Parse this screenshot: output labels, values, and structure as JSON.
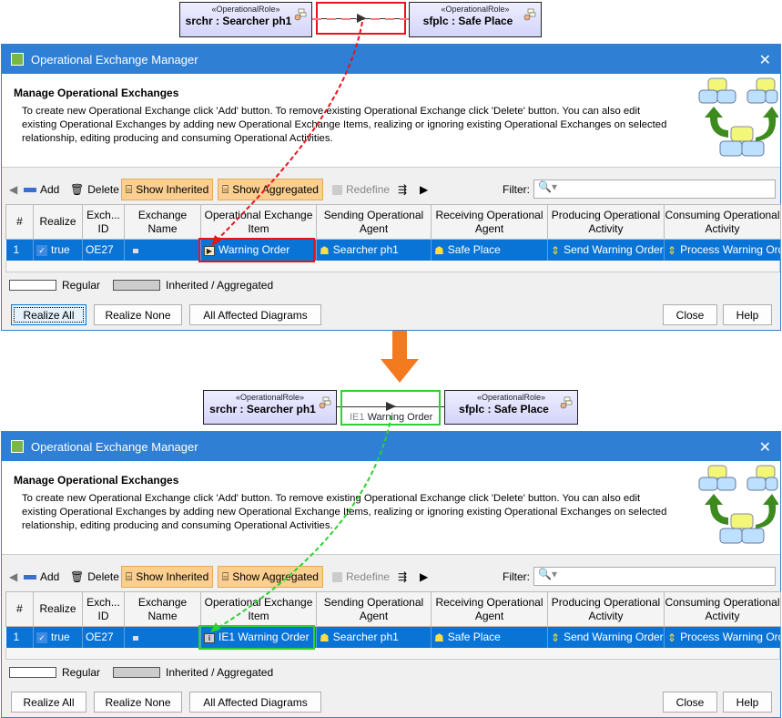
{
  "diagrams": [
    {
      "left": {
        "stereotype": "«OperationalRole»",
        "name": "srchr : Searcher ph1"
      },
      "right": {
        "stereotype": "«OperationalRole»",
        "name": "sfplc : Safe Place"
      },
      "connector_label": "",
      "highlight_color": "#e8141c"
    },
    {
      "left": {
        "stereotype": "«OperationalRole»",
        "name": "srchr : Searcher ph1"
      },
      "right": {
        "stereotype": "«OperationalRole»",
        "name": "sfplc : Safe Place"
      },
      "connector_label_prefix": "IE1",
      "connector_label": "Warning Order",
      "highlight_color": "#2fd12f"
    }
  ],
  "transition_arrow_color": "#f47a20",
  "dialogs": [
    {
      "title": "Operational Exchange Manager",
      "heading": "Manage Operational Exchanges",
      "description": "To create new Operational Exchange click 'Add' button. To remove existing Operational Exchange click 'Delete' button. You can also edit existing Operational Exchanges by adding new Operational Exchange Items, realizing or ignoring existing Operational Exchanges on selected relationship, editing producing and consuming Operational Activities.",
      "toolbar": {
        "add": "Add",
        "delete": "Delete",
        "show_inherited": "Show Inherited",
        "show_aggregated": "Show Aggregated",
        "redefine": "Redefine",
        "filter_label": "Filter:",
        "filter_value": ""
      },
      "columns": [
        "#",
        "Realize",
        "Exch... ID",
        "Exchange Name",
        "Operational Exchange Item",
        "Sending Operational Agent",
        "Receiving Operational Agent",
        "Producing Operational Activity",
        "Consuming Operational Activity"
      ],
      "row": {
        "num": "1",
        "realize": "true",
        "id": "OE27",
        "name": "",
        "item": "Warning Order",
        "item_icon": "signal-icon",
        "sending": "Searcher ph1",
        "receiving": "Safe Place",
        "producing": "Send Warning Order",
        "consuming": "Process Warning Order"
      },
      "legend": {
        "regular": "Regular",
        "inherited": "Inherited / Aggregated"
      },
      "buttons": {
        "realize_all": "Realize All",
        "realize_none": "Realize None",
        "affected": "All Affected Diagrams",
        "close": "Close",
        "help": "Help"
      }
    },
    {
      "title": "Operational Exchange Manager",
      "heading": "Manage Operational Exchanges",
      "description": "To create new Operational Exchange click 'Add' button. To remove existing Operational Exchange click 'Delete' button. You can also edit existing Operational Exchanges by adding new Operational Exchange Items, realizing or ignoring existing Operational Exchanges on selected relationship, editing producing and consuming Operational Activities.",
      "toolbar": {
        "add": "Add",
        "delete": "Delete",
        "show_inherited": "Show Inherited",
        "show_aggregated": "Show Aggregated",
        "redefine": "Redefine",
        "filter_label": "Filter:",
        "filter_value": ""
      },
      "columns": [
        "#",
        "Realize",
        "Exch... ID",
        "Exchange Name",
        "Operational Exchange Item",
        "Sending Operational Agent",
        "Receiving Operational Agent",
        "Producing Operational Activity",
        "Consuming Operational Activity"
      ],
      "row": {
        "num": "1",
        "realize": "true",
        "id": "OE27",
        "name": "",
        "item": "IE1 Warning Order",
        "item_icon": "information-icon",
        "sending": "Searcher ph1",
        "receiving": "Safe Place",
        "producing": "Send Warning Order",
        "consuming": "Process Warning Order"
      },
      "legend": {
        "regular": "Regular",
        "inherited": "Inherited / Aggregated"
      },
      "buttons": {
        "realize_all": "Realize All",
        "realize_none": "Realize None",
        "affected": "All Affected Diagrams",
        "close": "Close",
        "help": "Help"
      }
    }
  ]
}
